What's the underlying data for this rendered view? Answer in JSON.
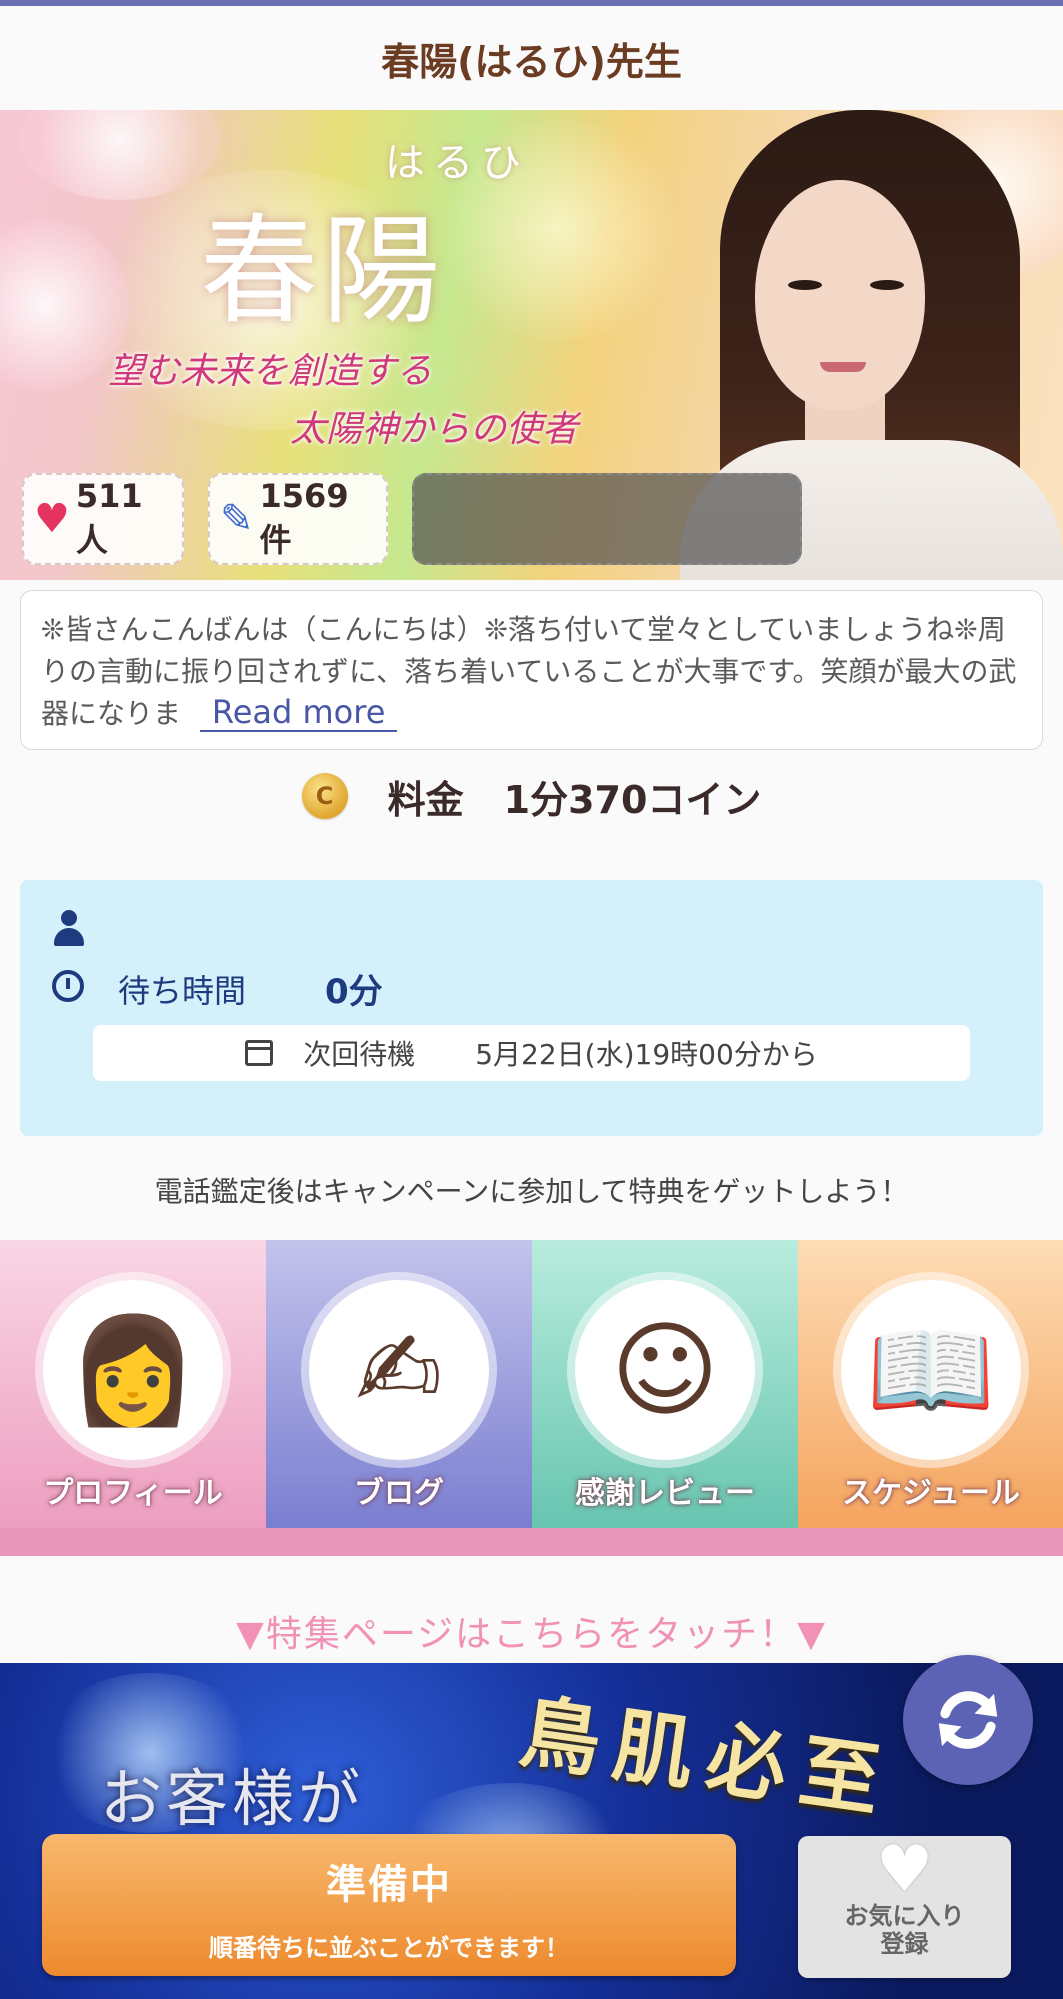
{
  "header": {
    "title": "春陽(はるひ)先生"
  },
  "hero": {
    "ruby": "はるひ",
    "name": "春陽",
    "tagline1": "望む未来を創造する",
    "tagline2": "太陽神からの使者"
  },
  "stats": {
    "favorites": "511人",
    "reviews": "1569件"
  },
  "intro": {
    "text": "❊皆さんこんばんは（こんにちは）❊落ち付いて堂々としていましょうね❊周りの言動に振り回されずに、落ち着いていることが大事です。笑顔が最大の武器になりま",
    "read_more": "Read more"
  },
  "price": {
    "coin_letter": "C",
    "label": "料金",
    "value": "1分370コイン"
  },
  "status": {
    "wait_label": "待ち時間",
    "wait_value": "0分",
    "next_label": "次回待機",
    "next_value": "5月22日(水)19時00分から"
  },
  "campaign": {
    "text": "電話鑑定後はキャンペーンに参加して特典をゲットしよう！"
  },
  "menu": [
    {
      "label": "プロフィール",
      "icon": "profile-icon"
    },
    {
      "label": "ブログ",
      "icon": "blog-icon"
    },
    {
      "label": "感謝レビュー",
      "icon": "smile-icon"
    },
    {
      "label": "スケジュール",
      "icon": "book-icon"
    }
  ],
  "feature": {
    "text": "▼特集ページはこちらをタッチ！▼"
  },
  "banner": {
    "text1": "お客様が",
    "text2": "鳥肌必至"
  },
  "actions": {
    "ready_title": "準備中",
    "ready_sub": "順番待ちに並ぶことができます！",
    "fav_label_line1": "お気に入り",
    "fav_label_line2": "登録"
  },
  "colors": {
    "accent": "#6a6fb3",
    "title_brown": "#6b3c22",
    "status_bg": "#d3f0fb",
    "ready_orange": "#ed8a2e",
    "feature_pink": "#f191b6"
  }
}
